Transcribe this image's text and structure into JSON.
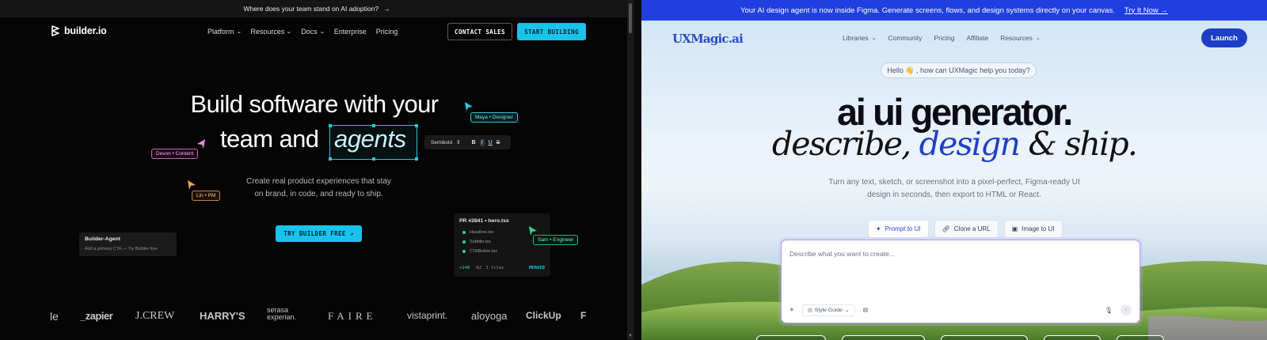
{
  "left": {
    "announcement": {
      "text": "Where does your team stand on AI adoption?",
      "arrow": "→"
    },
    "brand": {
      "name": "builder.io",
      "logo_icon": "builder-logo-icon"
    },
    "nav": [
      {
        "label": "Platform",
        "dropdown": true
      },
      {
        "label": "Resources",
        "dropdown": true
      },
      {
        "label": "Docs",
        "dropdown": true
      },
      {
        "label": "Enterprise",
        "dropdown": false
      },
      {
        "label": "Pricing",
        "dropdown": false
      }
    ],
    "buttons": {
      "contact": "CONTACT SALES",
      "start": "START BUILDING",
      "try": "TRY BUILDER FREE",
      "try_arrow": "↗"
    },
    "hero": {
      "line1": "Build software with your",
      "line2": "team and",
      "highlight": "agents"
    },
    "subtitle": {
      "line1": "Create real product experiences that stay",
      "line2": "on brand, in code, and ready to ship."
    },
    "format_toolbar": {
      "weight": "Semibold",
      "bold": "B",
      "italic": "I",
      "underline": "U",
      "strike": "S"
    },
    "collaborators": {
      "maya": "Maya • Designer",
      "devon": "Devon • Content",
      "lin": "Lin • PM",
      "sam": "Sam • Engineer"
    },
    "agent_card": {
      "title": "Builder-Agent",
      "desc": "Add a primary CTA — Try Builder free"
    },
    "pr_card": {
      "title": "PR #2841 • hero.tsx",
      "files": [
        "Headline.tsx",
        "Subtitle.tsx",
        "CTAButton.tsx"
      ],
      "additions": "+148",
      "deletions": "-62",
      "files_count": "3 files",
      "status": "MERGED"
    },
    "logos": [
      "le",
      "_zapier",
      "J.CREW",
      "HARRY'S",
      "serasa experian.",
      "FAIRE",
      "vistaprint.",
      "aloyoga",
      "ClickUp",
      "F"
    ],
    "colors": {
      "accent": "#18c4ec",
      "background": "#050505"
    }
  },
  "right": {
    "banner": {
      "text": "Your AI design agent is now inside Figma. Generate screens, flows, and design systems directly on your canvas.",
      "link": "Try It Now →"
    },
    "brand": {
      "name": "UXMagic.ai"
    },
    "nav": [
      {
        "label": "Libraries",
        "dropdown": true
      },
      {
        "label": "Community",
        "dropdown": false
      },
      {
        "label": "Pricing",
        "dropdown": false
      },
      {
        "label": "Affiliate",
        "dropdown": false
      },
      {
        "label": "Resources",
        "dropdown": true
      }
    ],
    "launch": "Launch",
    "hello": "Hello 👋 , how can UXMagic help you today?",
    "headline": "ai ui generator.",
    "tagline": {
      "part1": "describe, ",
      "part2": "design",
      "part3": " & ship."
    },
    "subtitle": {
      "line1": "Turn any text, sketch, or screenshot into a pixel-perfect, Figma-ready UI",
      "line2": "design in seconds, then export to HTML or React."
    },
    "tabs": [
      {
        "label": "Prompt to UI",
        "icon": "sparkle-icon",
        "active": true
      },
      {
        "label": "Clone a URL",
        "icon": "link-icon",
        "active": false
      },
      {
        "label": "Image to UI",
        "icon": "image-icon",
        "active": false
      }
    ],
    "prompt": {
      "placeholder": "Describe what you want to create...",
      "style_guide": "Style Guide"
    },
    "colors": {
      "banner": "#1f3fe0",
      "accent": "#1e40c8"
    }
  }
}
